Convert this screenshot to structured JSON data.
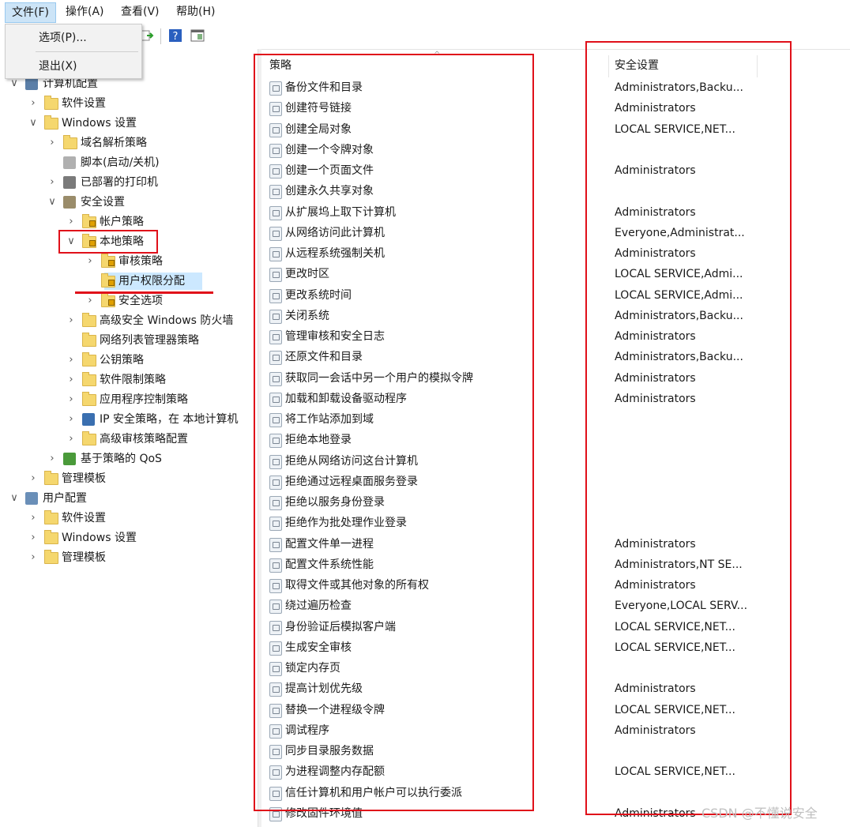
{
  "menubar": {
    "file": "文件(F)",
    "action": "操作(A)",
    "view": "查看(V)",
    "help": "帮助(H)"
  },
  "file_menu": {
    "options": "选项(P)...",
    "exit": "退出(X)"
  },
  "tree": [
    {
      "label": "计算机配置",
      "depth": 0,
      "chevron": "open",
      "icon": "computer-config-icon"
    },
    {
      "label": "软件设置",
      "depth": 1,
      "chevron": "closed",
      "icon": "folder-icon"
    },
    {
      "label": "Windows 设置",
      "depth": 1,
      "chevron": "open",
      "icon": "folder-icon"
    },
    {
      "label": "域名解析策略",
      "depth": 2,
      "chevron": "closed",
      "icon": "folder-icon"
    },
    {
      "label": "脚本(启动/关机)",
      "depth": 2,
      "chevron": "none",
      "icon": "script-icon"
    },
    {
      "label": "已部署的打印机",
      "depth": 2,
      "chevron": "closed",
      "icon": "printer-icon"
    },
    {
      "label": "安全设置",
      "depth": 2,
      "chevron": "open",
      "icon": "security-settings-icon"
    },
    {
      "label": "帐户策略",
      "depth": 3,
      "chevron": "closed",
      "icon": "lock-folder-icon"
    },
    {
      "label": "本地策略",
      "depth": 3,
      "chevron": "open",
      "icon": "lock-folder-icon"
    },
    {
      "label": "审核策略",
      "depth": 4,
      "chevron": "closed",
      "icon": "lock-folder-icon"
    },
    {
      "label": "用户权限分配",
      "depth": 4,
      "chevron": "none",
      "icon": "lock-folder-icon",
      "selected": true
    },
    {
      "label": "安全选项",
      "depth": 4,
      "chevron": "closed",
      "icon": "lock-folder-icon"
    },
    {
      "label": "高级安全 Windows 防火墙",
      "depth": 3,
      "chevron": "closed",
      "icon": "folder-icon"
    },
    {
      "label": "网络列表管理器策略",
      "depth": 3,
      "chevron": "none",
      "icon": "folder-icon"
    },
    {
      "label": "公钥策略",
      "depth": 3,
      "chevron": "closed",
      "icon": "folder-icon"
    },
    {
      "label": "软件限制策略",
      "depth": 3,
      "chevron": "closed",
      "icon": "folder-icon"
    },
    {
      "label": "应用程序控制策略",
      "depth": 3,
      "chevron": "closed",
      "icon": "folder-icon"
    },
    {
      "label": "IP 安全策略，在 本地计算机",
      "depth": 3,
      "chevron": "closed",
      "icon": "ip-security-icon"
    },
    {
      "label": "高级审核策略配置",
      "depth": 3,
      "chevron": "closed",
      "icon": "folder-icon"
    },
    {
      "label": "基于策略的 QoS",
      "depth": 2,
      "chevron": "closed",
      "icon": "qos-chart-icon"
    },
    {
      "label": "管理模板",
      "depth": 1,
      "chevron": "closed",
      "icon": "folder-icon"
    },
    {
      "label": "用户配置",
      "depth": 0,
      "chevron": "open",
      "icon": "user-config-icon"
    },
    {
      "label": "软件设置",
      "depth": 1,
      "chevron": "closed",
      "icon": "folder-icon"
    },
    {
      "label": "Windows 设置",
      "depth": 1,
      "chevron": "closed",
      "icon": "folder-icon"
    },
    {
      "label": "管理模板",
      "depth": 1,
      "chevron": "closed",
      "icon": "folder-icon"
    }
  ],
  "list": {
    "col_policy": "策略",
    "col_security": "安全设置",
    "rows": [
      {
        "policy": "备份文件和目录",
        "setting": "Administrators,Backu..."
      },
      {
        "policy": "创建符号链接",
        "setting": "Administrators"
      },
      {
        "policy": "创建全局对象",
        "setting": "LOCAL SERVICE,NET..."
      },
      {
        "policy": "创建一个令牌对象",
        "setting": ""
      },
      {
        "policy": "创建一个页面文件",
        "setting": "Administrators"
      },
      {
        "policy": "创建永久共享对象",
        "setting": ""
      },
      {
        "policy": "从扩展坞上取下计算机",
        "setting": "Administrators"
      },
      {
        "policy": "从网络访问此计算机",
        "setting": "Everyone,Administrat..."
      },
      {
        "policy": "从远程系统强制关机",
        "setting": "Administrators"
      },
      {
        "policy": "更改时区",
        "setting": "LOCAL SERVICE,Admi..."
      },
      {
        "policy": "更改系统时间",
        "setting": "LOCAL SERVICE,Admi..."
      },
      {
        "policy": "关闭系统",
        "setting": "Administrators,Backu..."
      },
      {
        "policy": "管理审核和安全日志",
        "setting": "Administrators"
      },
      {
        "policy": "还原文件和目录",
        "setting": "Administrators,Backu..."
      },
      {
        "policy": "获取同一会话中另一个用户的模拟令牌",
        "setting": "Administrators"
      },
      {
        "policy": "加载和卸载设备驱动程序",
        "setting": "Administrators"
      },
      {
        "policy": "将工作站添加到域",
        "setting": ""
      },
      {
        "policy": "拒绝本地登录",
        "setting": ""
      },
      {
        "policy": "拒绝从网络访问这台计算机",
        "setting": ""
      },
      {
        "policy": "拒绝通过远程桌面服务登录",
        "setting": ""
      },
      {
        "policy": "拒绝以服务身份登录",
        "setting": ""
      },
      {
        "policy": "拒绝作为批处理作业登录",
        "setting": ""
      },
      {
        "policy": "配置文件单一进程",
        "setting": "Administrators"
      },
      {
        "policy": "配置文件系统性能",
        "setting": "Administrators,NT SE..."
      },
      {
        "policy": "取得文件或其他对象的所有权",
        "setting": "Administrators"
      },
      {
        "policy": "绕过遍历检查",
        "setting": "Everyone,LOCAL SERV..."
      },
      {
        "policy": "身份验证后模拟客户端",
        "setting": "LOCAL SERVICE,NET..."
      },
      {
        "policy": "生成安全审核",
        "setting": "LOCAL SERVICE,NET..."
      },
      {
        "policy": "锁定内存页",
        "setting": ""
      },
      {
        "policy": "提高计划优先级",
        "setting": "Administrators"
      },
      {
        "policy": "替换一个进程级令牌",
        "setting": "LOCAL SERVICE,NET..."
      },
      {
        "policy": "调试程序",
        "setting": "Administrators"
      },
      {
        "policy": "同步目录服务数据",
        "setting": ""
      },
      {
        "policy": "为进程调整内存配额",
        "setting": "LOCAL SERVICE,NET..."
      },
      {
        "policy": "信任计算机和用户帐户可以执行委派",
        "setting": ""
      },
      {
        "policy": "修改固件环境值",
        "setting": "Administrators"
      }
    ]
  },
  "watermark": "CSDN @不懂说安全",
  "colors": {
    "highlight": "#e0101a",
    "selection": "#cce8ff",
    "menu_active": "#cce4f7"
  }
}
